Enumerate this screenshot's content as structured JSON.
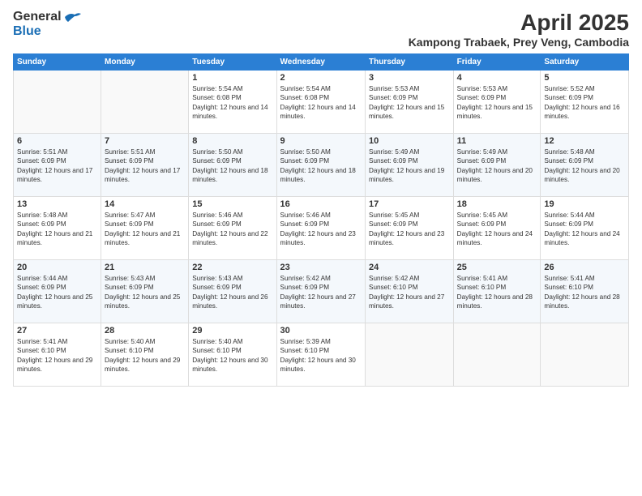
{
  "header": {
    "logo_general": "General",
    "logo_blue": "Blue",
    "month_year": "April 2025",
    "location": "Kampong Trabaek, Prey Veng, Cambodia"
  },
  "days_of_week": [
    "Sunday",
    "Monday",
    "Tuesday",
    "Wednesday",
    "Thursday",
    "Friday",
    "Saturday"
  ],
  "weeks": [
    [
      {
        "day": "",
        "sunrise": "",
        "sunset": "",
        "daylight": ""
      },
      {
        "day": "",
        "sunrise": "",
        "sunset": "",
        "daylight": ""
      },
      {
        "day": "1",
        "sunrise": "Sunrise: 5:54 AM",
        "sunset": "Sunset: 6:08 PM",
        "daylight": "Daylight: 12 hours and 14 minutes."
      },
      {
        "day": "2",
        "sunrise": "Sunrise: 5:54 AM",
        "sunset": "Sunset: 6:08 PM",
        "daylight": "Daylight: 12 hours and 14 minutes."
      },
      {
        "day": "3",
        "sunrise": "Sunrise: 5:53 AM",
        "sunset": "Sunset: 6:09 PM",
        "daylight": "Daylight: 12 hours and 15 minutes."
      },
      {
        "day": "4",
        "sunrise": "Sunrise: 5:53 AM",
        "sunset": "Sunset: 6:09 PM",
        "daylight": "Daylight: 12 hours and 15 minutes."
      },
      {
        "day": "5",
        "sunrise": "Sunrise: 5:52 AM",
        "sunset": "Sunset: 6:09 PM",
        "daylight": "Daylight: 12 hours and 16 minutes."
      }
    ],
    [
      {
        "day": "6",
        "sunrise": "Sunrise: 5:51 AM",
        "sunset": "Sunset: 6:09 PM",
        "daylight": "Daylight: 12 hours and 17 minutes."
      },
      {
        "day": "7",
        "sunrise": "Sunrise: 5:51 AM",
        "sunset": "Sunset: 6:09 PM",
        "daylight": "Daylight: 12 hours and 17 minutes."
      },
      {
        "day": "8",
        "sunrise": "Sunrise: 5:50 AM",
        "sunset": "Sunset: 6:09 PM",
        "daylight": "Daylight: 12 hours and 18 minutes."
      },
      {
        "day": "9",
        "sunrise": "Sunrise: 5:50 AM",
        "sunset": "Sunset: 6:09 PM",
        "daylight": "Daylight: 12 hours and 18 minutes."
      },
      {
        "day": "10",
        "sunrise": "Sunrise: 5:49 AM",
        "sunset": "Sunset: 6:09 PM",
        "daylight": "Daylight: 12 hours and 19 minutes."
      },
      {
        "day": "11",
        "sunrise": "Sunrise: 5:49 AM",
        "sunset": "Sunset: 6:09 PM",
        "daylight": "Daylight: 12 hours and 20 minutes."
      },
      {
        "day": "12",
        "sunrise": "Sunrise: 5:48 AM",
        "sunset": "Sunset: 6:09 PM",
        "daylight": "Daylight: 12 hours and 20 minutes."
      }
    ],
    [
      {
        "day": "13",
        "sunrise": "Sunrise: 5:48 AM",
        "sunset": "Sunset: 6:09 PM",
        "daylight": "Daylight: 12 hours and 21 minutes."
      },
      {
        "day": "14",
        "sunrise": "Sunrise: 5:47 AM",
        "sunset": "Sunset: 6:09 PM",
        "daylight": "Daylight: 12 hours and 21 minutes."
      },
      {
        "day": "15",
        "sunrise": "Sunrise: 5:46 AM",
        "sunset": "Sunset: 6:09 PM",
        "daylight": "Daylight: 12 hours and 22 minutes."
      },
      {
        "day": "16",
        "sunrise": "Sunrise: 5:46 AM",
        "sunset": "Sunset: 6:09 PM",
        "daylight": "Daylight: 12 hours and 23 minutes."
      },
      {
        "day": "17",
        "sunrise": "Sunrise: 5:45 AM",
        "sunset": "Sunset: 6:09 PM",
        "daylight": "Daylight: 12 hours and 23 minutes."
      },
      {
        "day": "18",
        "sunrise": "Sunrise: 5:45 AM",
        "sunset": "Sunset: 6:09 PM",
        "daylight": "Daylight: 12 hours and 24 minutes."
      },
      {
        "day": "19",
        "sunrise": "Sunrise: 5:44 AM",
        "sunset": "Sunset: 6:09 PM",
        "daylight": "Daylight: 12 hours and 24 minutes."
      }
    ],
    [
      {
        "day": "20",
        "sunrise": "Sunrise: 5:44 AM",
        "sunset": "Sunset: 6:09 PM",
        "daylight": "Daylight: 12 hours and 25 minutes."
      },
      {
        "day": "21",
        "sunrise": "Sunrise: 5:43 AM",
        "sunset": "Sunset: 6:09 PM",
        "daylight": "Daylight: 12 hours and 25 minutes."
      },
      {
        "day": "22",
        "sunrise": "Sunrise: 5:43 AM",
        "sunset": "Sunset: 6:09 PM",
        "daylight": "Daylight: 12 hours and 26 minutes."
      },
      {
        "day": "23",
        "sunrise": "Sunrise: 5:42 AM",
        "sunset": "Sunset: 6:09 PM",
        "daylight": "Daylight: 12 hours and 27 minutes."
      },
      {
        "day": "24",
        "sunrise": "Sunrise: 5:42 AM",
        "sunset": "Sunset: 6:10 PM",
        "daylight": "Daylight: 12 hours and 27 minutes."
      },
      {
        "day": "25",
        "sunrise": "Sunrise: 5:41 AM",
        "sunset": "Sunset: 6:10 PM",
        "daylight": "Daylight: 12 hours and 28 minutes."
      },
      {
        "day": "26",
        "sunrise": "Sunrise: 5:41 AM",
        "sunset": "Sunset: 6:10 PM",
        "daylight": "Daylight: 12 hours and 28 minutes."
      }
    ],
    [
      {
        "day": "27",
        "sunrise": "Sunrise: 5:41 AM",
        "sunset": "Sunset: 6:10 PM",
        "daylight": "Daylight: 12 hours and 29 minutes."
      },
      {
        "day": "28",
        "sunrise": "Sunrise: 5:40 AM",
        "sunset": "Sunset: 6:10 PM",
        "daylight": "Daylight: 12 hours and 29 minutes."
      },
      {
        "day": "29",
        "sunrise": "Sunrise: 5:40 AM",
        "sunset": "Sunset: 6:10 PM",
        "daylight": "Daylight: 12 hours and 30 minutes."
      },
      {
        "day": "30",
        "sunrise": "Sunrise: 5:39 AM",
        "sunset": "Sunset: 6:10 PM",
        "daylight": "Daylight: 12 hours and 30 minutes."
      },
      {
        "day": "",
        "sunrise": "",
        "sunset": "",
        "daylight": ""
      },
      {
        "day": "",
        "sunrise": "",
        "sunset": "",
        "daylight": ""
      },
      {
        "day": "",
        "sunrise": "",
        "sunset": "",
        "daylight": ""
      }
    ]
  ]
}
